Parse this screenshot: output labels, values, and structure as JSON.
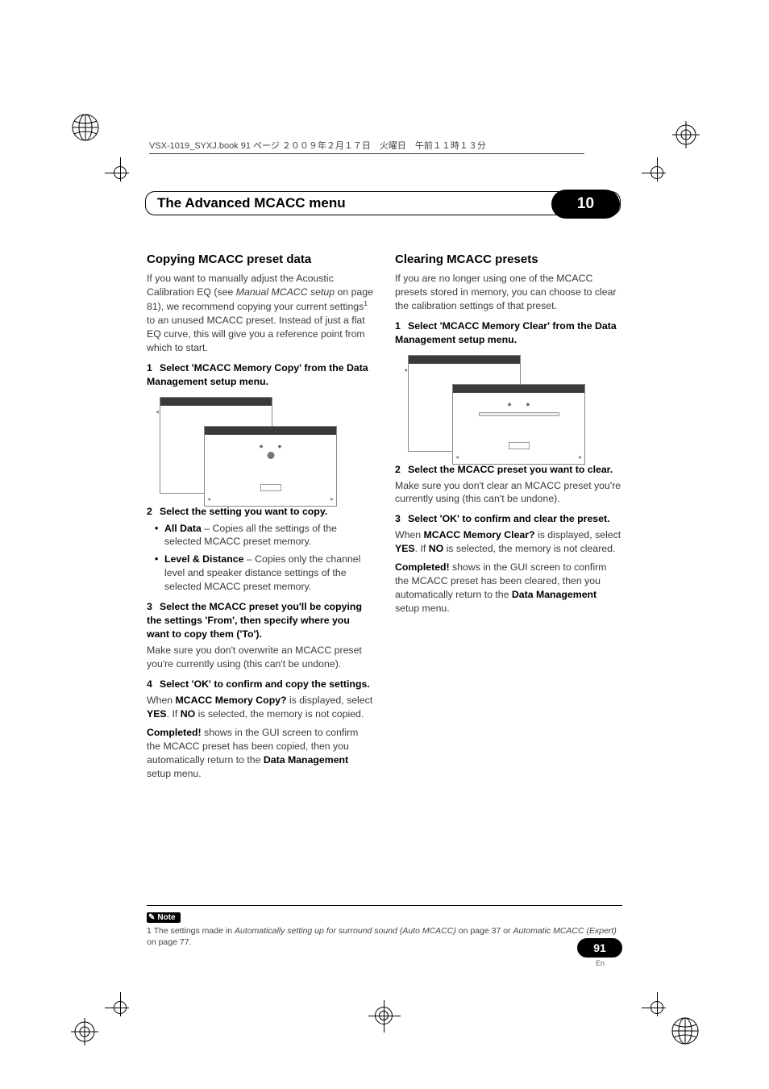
{
  "header_line": "VSX-1019_SYXJ.book  91 ページ  ２００９年２月１７日　火曜日　午前１１時１３分",
  "chapter": {
    "title": "The Advanced MCACC menu",
    "number": "10"
  },
  "left": {
    "h": "Copying MCACC preset data",
    "intro_1": "If you want to manually adjust the Acoustic Calibration EQ (see ",
    "intro_ital": "Manual MCACC setup",
    "intro_2": " on page 81), we recommend copying your current settings",
    "intro_sup": "1",
    "intro_3": " to an unused MCACC preset. Instead of just a flat EQ curve, this will give you a reference point from which to start.",
    "step1": "Select 'MCACC Memory Copy' from the Data Management setup menu.",
    "step2": "Select the setting you want to copy.",
    "bullet1_b": "All Data",
    "bullet1_t": " – Copies all the settings of the selected MCACC preset memory.",
    "bullet2_b": "Level & Distance",
    "bullet2_t": " – Copies only the channel level and speaker distance settings of the selected MCACC preset memory.",
    "step3": "Select the MCACC preset you'll be copying the settings 'From', then specify where you want to copy them ('To').",
    "step3_t": "Make sure you don't overwrite an MCACC preset you're currently using (this can't be undone).",
    "step4": "Select 'OK' to confirm and copy the settings.",
    "step4_t1": "When ",
    "step4_b1": "MCACC Memory Copy?",
    "step4_t2": " is displayed, select ",
    "step4_b2": "YES",
    "step4_t3": ". If ",
    "step4_b3": "NO",
    "step4_t4": " is selected, the memory is not copied.",
    "done_b": "Completed!",
    "done_t1": " shows in the GUI screen to confirm the MCACC preset has been copied, then you automatically return to the ",
    "done_b2": "Data Management",
    "done_t2": " setup menu."
  },
  "right": {
    "h": "Clearing MCACC presets",
    "intro": "If you are no longer using one of the MCACC presets stored in memory, you can choose to clear the calibration settings of that preset.",
    "step1": "Select 'MCACC Memory Clear' from the Data Management setup menu.",
    "step2": "Select the MCACC preset you want to clear.",
    "step2_t": "Make sure you don't clear an MCACC preset you're currently using (this can't be undone).",
    "step3": "Select 'OK' to confirm and clear the preset.",
    "step3_t1": "When ",
    "step3_b1": "MCACC Memory Clear?",
    "step3_t2": " is displayed, select ",
    "step3_b2": "YES",
    "step3_t3": ". If ",
    "step3_b3": "NO",
    "step3_t4": " is selected, the memory is not cleared.",
    "done_b": "Completed!",
    "done_t1": " shows in the GUI screen to confirm the MCACC preset has been cleared, then you automatically return to the ",
    "done_b2": "Data Management",
    "done_t2": " setup menu."
  },
  "footnote": {
    "label": "Note",
    "t1": "1 The settings made in ",
    "i1": "Automatically setting up for surround sound (Auto MCACC)",
    "t2": " on page 37 or ",
    "i2": "Automatic MCACC (Expert)",
    "t3": " on page 77."
  },
  "page_number": "91",
  "page_lang": "En"
}
